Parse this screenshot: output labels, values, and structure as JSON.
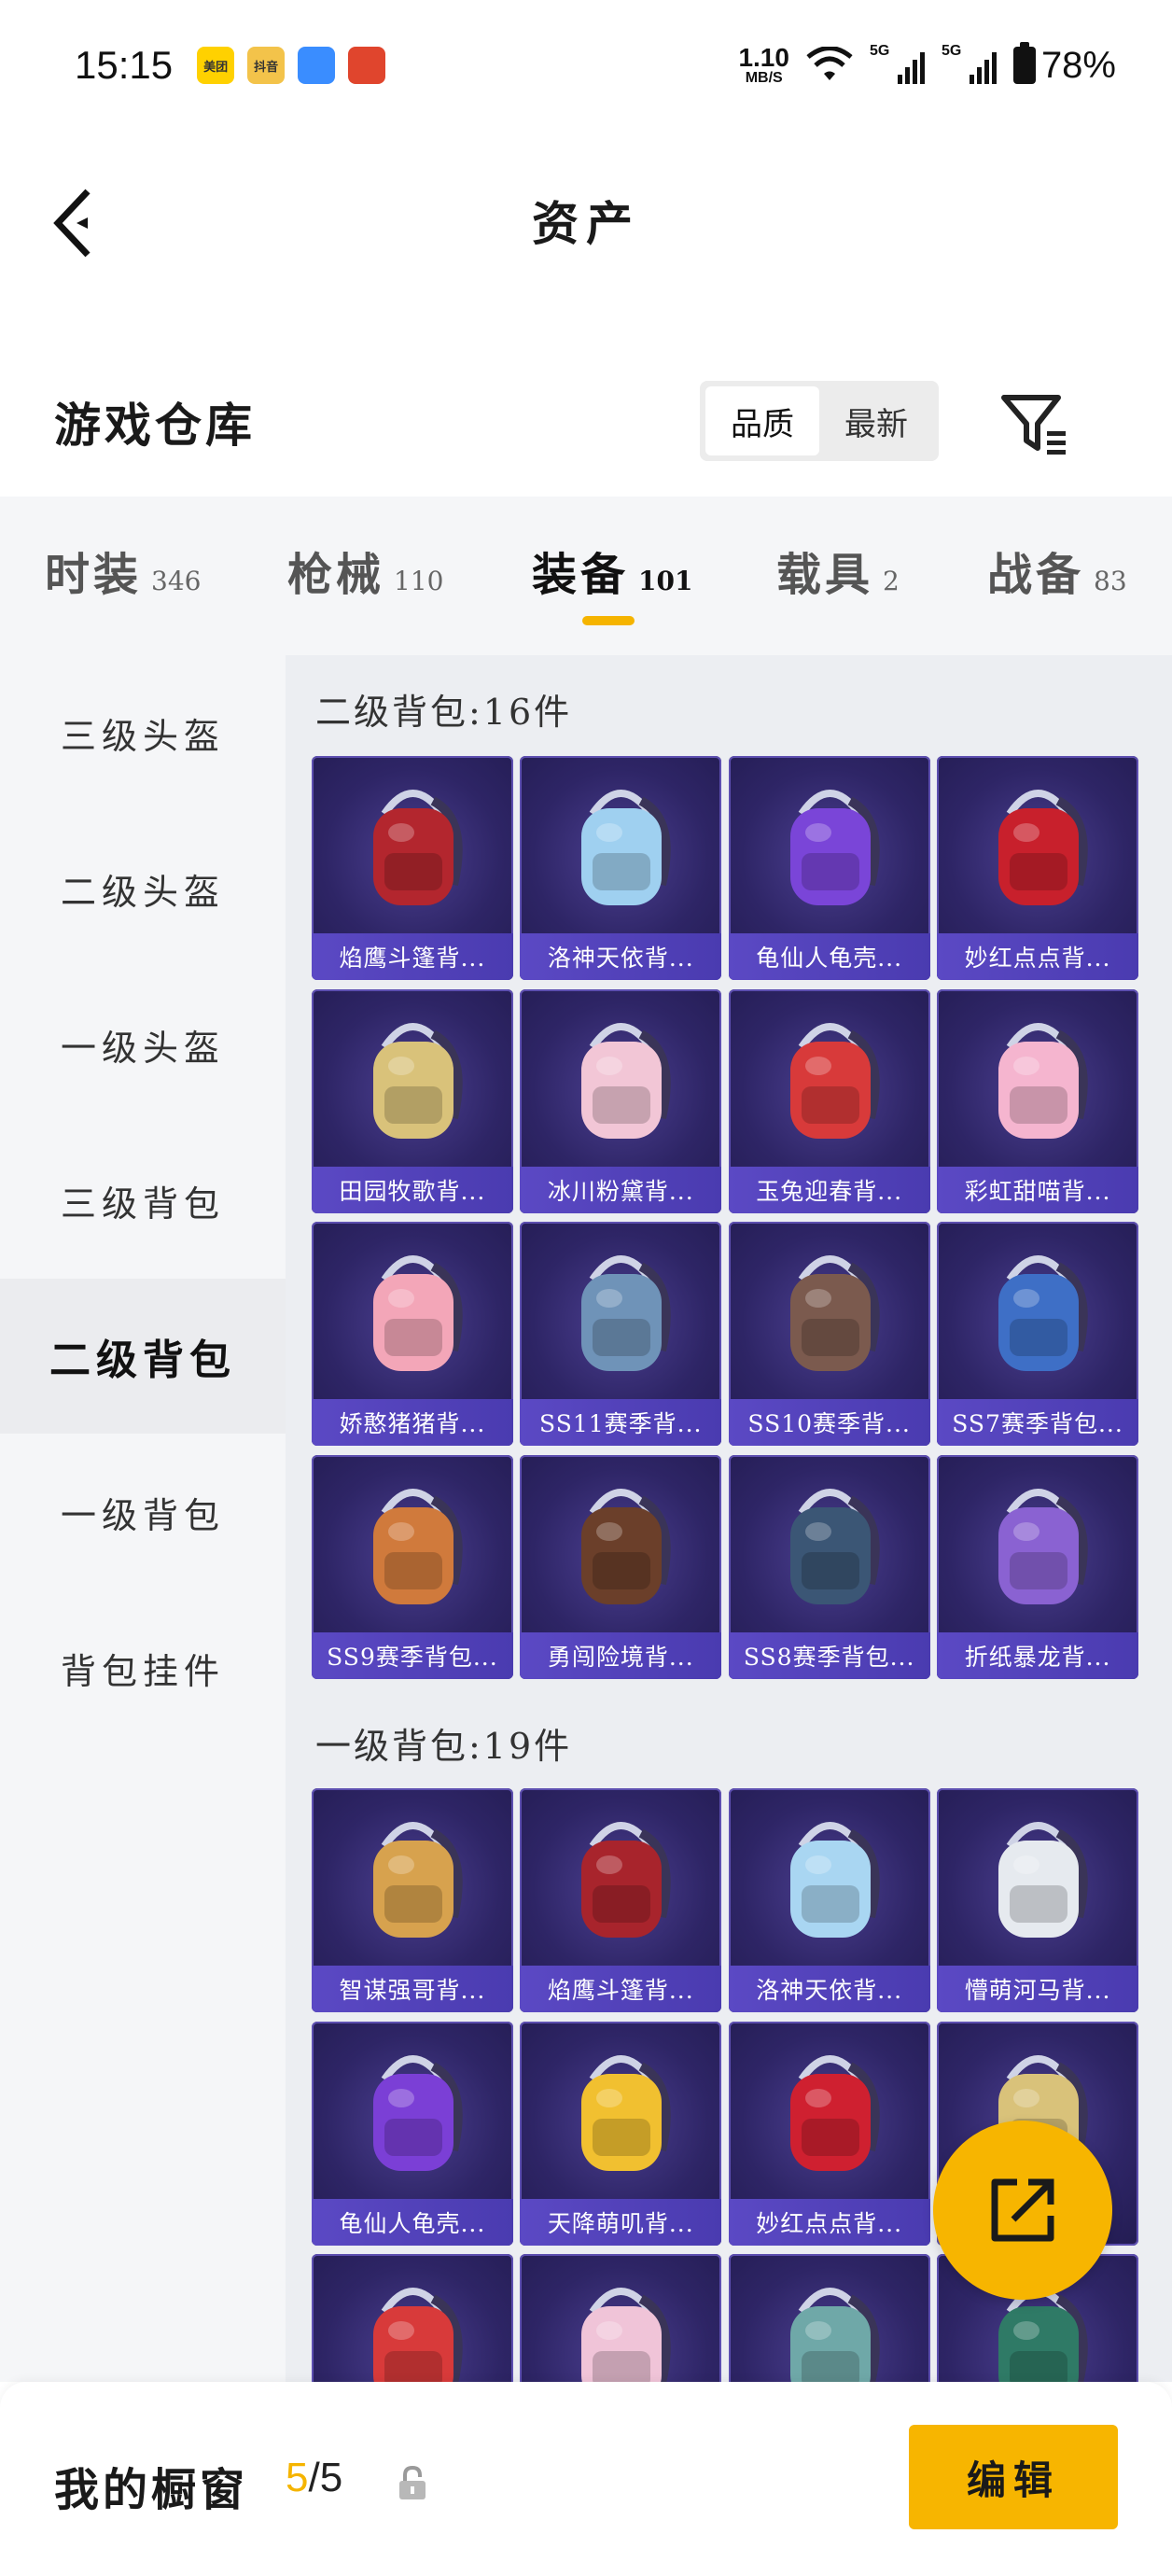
{
  "status_bar": {
    "time": "15:15",
    "app_icons": [
      {
        "name": "meituan-app-icon",
        "label": "美团",
        "color": "#ffd100"
      },
      {
        "name": "news-app-icon",
        "label": "抖音",
        "color": "#f3c34a"
      },
      {
        "name": "browser-app-icon",
        "label": "",
        "color": "#3a8dff"
      },
      {
        "name": "game-app-icon",
        "label": "",
        "color": "#e0452d"
      }
    ],
    "net_speed": "1.10",
    "net_unit": "MB/S",
    "signal_tag_1": "5G",
    "signal_tag_2": "5G",
    "battery": "78%"
  },
  "header": {
    "title": "资产",
    "back_icon": "chevron-left-icon"
  },
  "warehouse": {
    "title": "游戏仓库",
    "sort_options": [
      "品质",
      "最新"
    ],
    "active_sort": 0,
    "filter_icon": "filter-icon"
  },
  "tabs": [
    {
      "label": "时装",
      "count": "346"
    },
    {
      "label": "枪械",
      "count": "110"
    },
    {
      "label": "装备",
      "count": "101"
    },
    {
      "label": "载具",
      "count": "2"
    },
    {
      "label": "战备",
      "count": "83"
    }
  ],
  "active_tab": 2,
  "sidebar": {
    "items": [
      "三级头盔",
      "二级头盔",
      "一级头盔",
      "三级背包",
      "二级背包",
      "一级背包",
      "背包挂件"
    ],
    "active": 4
  },
  "sections": [
    {
      "title": "二级背包:16件",
      "items": [
        {
          "name": "焰鹰斗篷背...",
          "color": "#b3262e"
        },
        {
          "name": "洛神天依背...",
          "color": "#9fd0f0"
        },
        {
          "name": "龟仙人龟壳...",
          "color": "#7a45d8"
        },
        {
          "name": "妙红点点背...",
          "color": "#c8202c"
        },
        {
          "name": "田园牧歌背...",
          "color": "#d9c27a"
        },
        {
          "name": "冰川粉黛背...",
          "color": "#f2c6d6"
        },
        {
          "name": "玉兔迎春背...",
          "color": "#d83a3a"
        },
        {
          "name": "彩虹甜喵背...",
          "color": "#f5b5cf"
        },
        {
          "name": "娇憨猪猪背...",
          "color": "#f3a6b8"
        },
        {
          "name": "SS11赛季背...",
          "color": "#6f93b8"
        },
        {
          "name": "SS10赛季背...",
          "color": "#7b5a4e"
        },
        {
          "name": "SS7赛季背包...",
          "color": "#3e6fc6"
        },
        {
          "name": "SS9赛季背包...",
          "color": "#d07a3c"
        },
        {
          "name": "勇闯险境背...",
          "color": "#6b3f2a"
        },
        {
          "name": "SS8赛季背包...",
          "color": "#3b5675"
        },
        {
          "name": "折纸暴龙背...",
          "color": "#8a62d2"
        }
      ]
    },
    {
      "title": "一级背包:19件",
      "items": [
        {
          "name": "智谋强哥背...",
          "color": "#d7a24e"
        },
        {
          "name": "焰鹰斗篷背...",
          "color": "#a8242c"
        },
        {
          "name": "洛神天依背...",
          "color": "#a9d6f2"
        },
        {
          "name": "懵萌河马背...",
          "color": "#e6eaef"
        },
        {
          "name": "龟仙人龟壳...",
          "color": "#7b3fd6"
        },
        {
          "name": "天降萌叽背...",
          "color": "#f1c030"
        },
        {
          "name": "妙红点点背...",
          "color": "#cf2030"
        },
        {
          "name": "",
          "color": "#d9c27a"
        },
        {
          "name": "",
          "color": "#d83a3a"
        },
        {
          "name": "",
          "color": "#f0c4d8"
        },
        {
          "name": "",
          "color": "#6fa8a8"
        },
        {
          "name": "",
          "color": "#2f7a66"
        }
      ]
    }
  ],
  "fab_icon": "share-external-icon",
  "bottom_bar": {
    "label": "我的橱窗",
    "current": "5",
    "separator": "/",
    "max": "5",
    "lock_icon": "lock-icon",
    "edit_label": "编辑"
  },
  "colors": {
    "accent": "#f7b500",
    "card_bg": "#2e2566",
    "card_label": "#5b49c4"
  }
}
